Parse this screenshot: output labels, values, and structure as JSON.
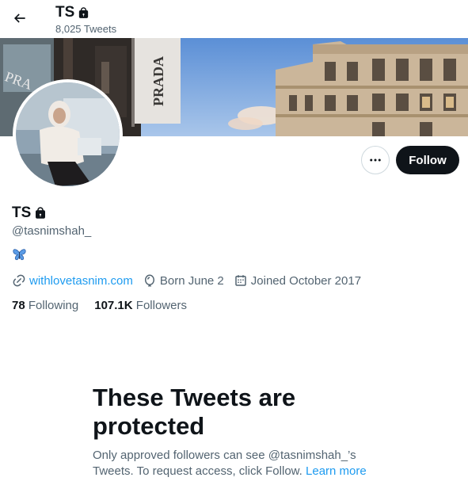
{
  "header": {
    "display_name": "TS",
    "tweet_count": "8,025 Tweets",
    "back_icon": "arrow-left-icon",
    "lock_icon": "lock-icon"
  },
  "banner": {
    "storefront_sign": "PRADA",
    "sign_left": "PRA"
  },
  "profile": {
    "display_name": "TS",
    "handle": "@tasnimshah_",
    "bio": "🦋",
    "website": "withlovetasnim.com",
    "birthday": "Born June 2",
    "joined": "Joined October 2017"
  },
  "actions": {
    "follow_label": "Follow",
    "more_icon": "more-horizontal-icon"
  },
  "stats": {
    "following_count": "78",
    "following_label": "Following",
    "followers_count": "107.1K",
    "followers_label": "Followers"
  },
  "protected": {
    "title": "These Tweets are protected",
    "message": "Only approved followers can see @tasnimshah_’s Tweets. To request access, click Follow.",
    "learn_more": "Learn more"
  },
  "colors": {
    "accent": "#1d9bf0",
    "text_primary": "#0f1419",
    "text_secondary": "#536471",
    "follow_button_bg": "#0f1419"
  }
}
